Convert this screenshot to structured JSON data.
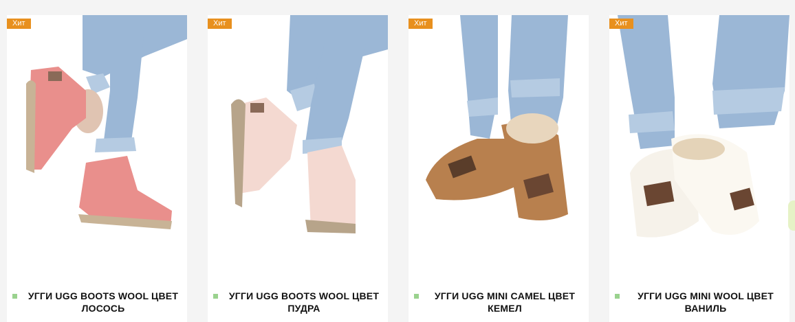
{
  "products": [
    {
      "badge": "Хит",
      "title_line1": "УГГИ UGG BOOTS WOOL ЦВЕТ",
      "title_line2": "ЛОСОСЬ",
      "icon": "boot-image",
      "color": "#e98f8c"
    },
    {
      "badge": "Хит",
      "title_line1": "УГГИ UGG BOOTS WOOL ЦВЕТ",
      "title_line2": "ПУДРА",
      "icon": "boot-image",
      "color": "#f4d9d1"
    },
    {
      "badge": "Хит",
      "title_line1": "УГГИ UGG MINI CAMEL ЦВЕТ",
      "title_line2": "КЕМЕЛ",
      "icon": "slipper-image",
      "color": "#b8804e"
    },
    {
      "badge": "Хит",
      "title_line1": "УГГИ UGG MINI WOOL ЦВЕТ",
      "title_line2": "ВАНИЛЬ",
      "icon": "slipper-image",
      "color": "#f6f2ea"
    }
  ],
  "colors": {
    "badge": "#e8901e",
    "bullet": "#9ad28e",
    "jeans": "#9bb7d6",
    "background": "#f4f4f4"
  }
}
